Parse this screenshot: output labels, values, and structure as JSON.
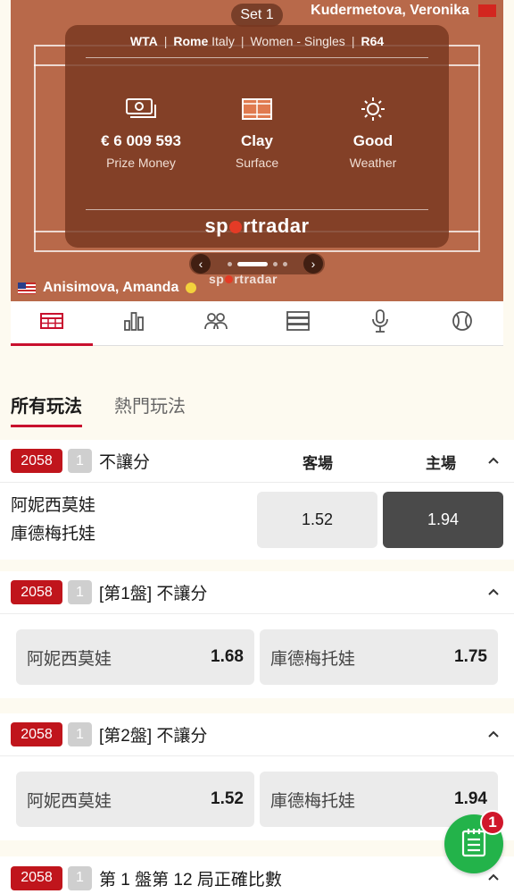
{
  "tracker": {
    "set_label": "Set 1",
    "player_away": "Kudermetova, Veronika",
    "player_home": "Anisimova, Amanda",
    "info": {
      "tour": "WTA",
      "city": "Rome",
      "country": "Italy",
      "event": "Women - Singles",
      "round": "R64"
    },
    "stats": [
      {
        "value": "€ 6 009 593",
        "label": "Prize Money",
        "icon": "money-icon"
      },
      {
        "value": "Clay",
        "label": "Surface",
        "icon": "court-icon"
      },
      {
        "value": "Good",
        "label": "Weather",
        "icon": "sun-icon"
      }
    ],
    "brand_pre": "sp",
    "brand_mid": "rt",
    "brand_post": "radar"
  },
  "icon_tabs": [
    "scoreboard-icon",
    "stats-icon",
    "head-to-head-icon",
    "timeline-icon",
    "commentary-icon",
    "tennis-ball-icon"
  ],
  "bet_tabs": {
    "all": "所有玩法",
    "hot": "熱門玩法"
  },
  "markets": [
    {
      "code": "2058",
      "num": "1",
      "title": "不讓分",
      "col_away": "客場",
      "col_home": "主場",
      "player_1": "阿妮西莫娃",
      "player_2": "庫德梅托娃",
      "odd_away": "1.52",
      "odd_home": "1.94"
    },
    {
      "code": "2058",
      "num": "1",
      "title": "[第1盤] 不讓分",
      "sel_1": "阿妮西莫娃",
      "odd_1": "1.68",
      "sel_2": "庫德梅托娃",
      "odd_2": "1.75"
    },
    {
      "code": "2058",
      "num": "1",
      "title": "[第2盤] 不讓分",
      "sel_1": "阿妮西莫娃",
      "odd_1": "1.52",
      "sel_2": "庫德梅托娃",
      "odd_2": "1.94"
    },
    {
      "code": "2058",
      "num": "1",
      "title": "第 1 盤第 12 局正確比數"
    }
  ],
  "betslip": {
    "count": "1",
    "icon": "betslip-icon"
  },
  "colors": {
    "brand_red": "#c0151c",
    "clay": "#b8694a",
    "fab_green": "#23b34a"
  }
}
